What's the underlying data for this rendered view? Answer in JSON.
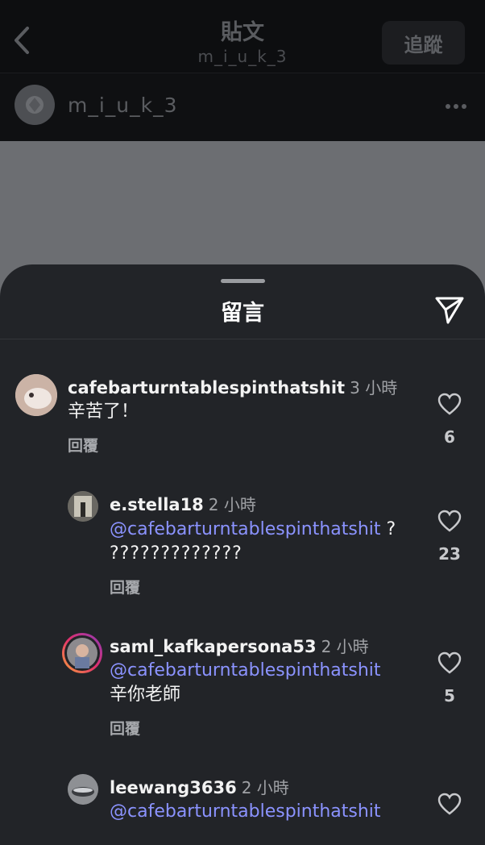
{
  "header": {
    "title": "貼文",
    "subtitle": "m_i_u_k_3",
    "follow_label": "追蹤"
  },
  "author": {
    "name": "m_i_u_k_3"
  },
  "sheet": {
    "title": "留言"
  },
  "comments": [
    {
      "username": "cafebarturntablespinthatshit",
      "time": "3 小時",
      "text": "辛苦了！",
      "reply": "回覆",
      "likes": "6"
    },
    {
      "username": "e.stella18",
      "time": "2 小時",
      "mention": "@cafebarturntablespinthatshit",
      "text_inline": " ?",
      "text": "?????????????",
      "reply": "回覆",
      "likes": "23"
    },
    {
      "username": "saml_kafkapersona53",
      "time": "2 小時",
      "mention": "@cafebarturntablespinthatshit",
      "text": "辛你老師",
      "reply": "回覆",
      "likes": "5"
    },
    {
      "username": "leewang3636",
      "time": "2 小時",
      "mention": "@cafebarturntablespinthatshit"
    }
  ],
  "colors": {
    "sheet_bg": "#222428",
    "mention": "#8b93ff",
    "story_ring": "#e1306c"
  }
}
